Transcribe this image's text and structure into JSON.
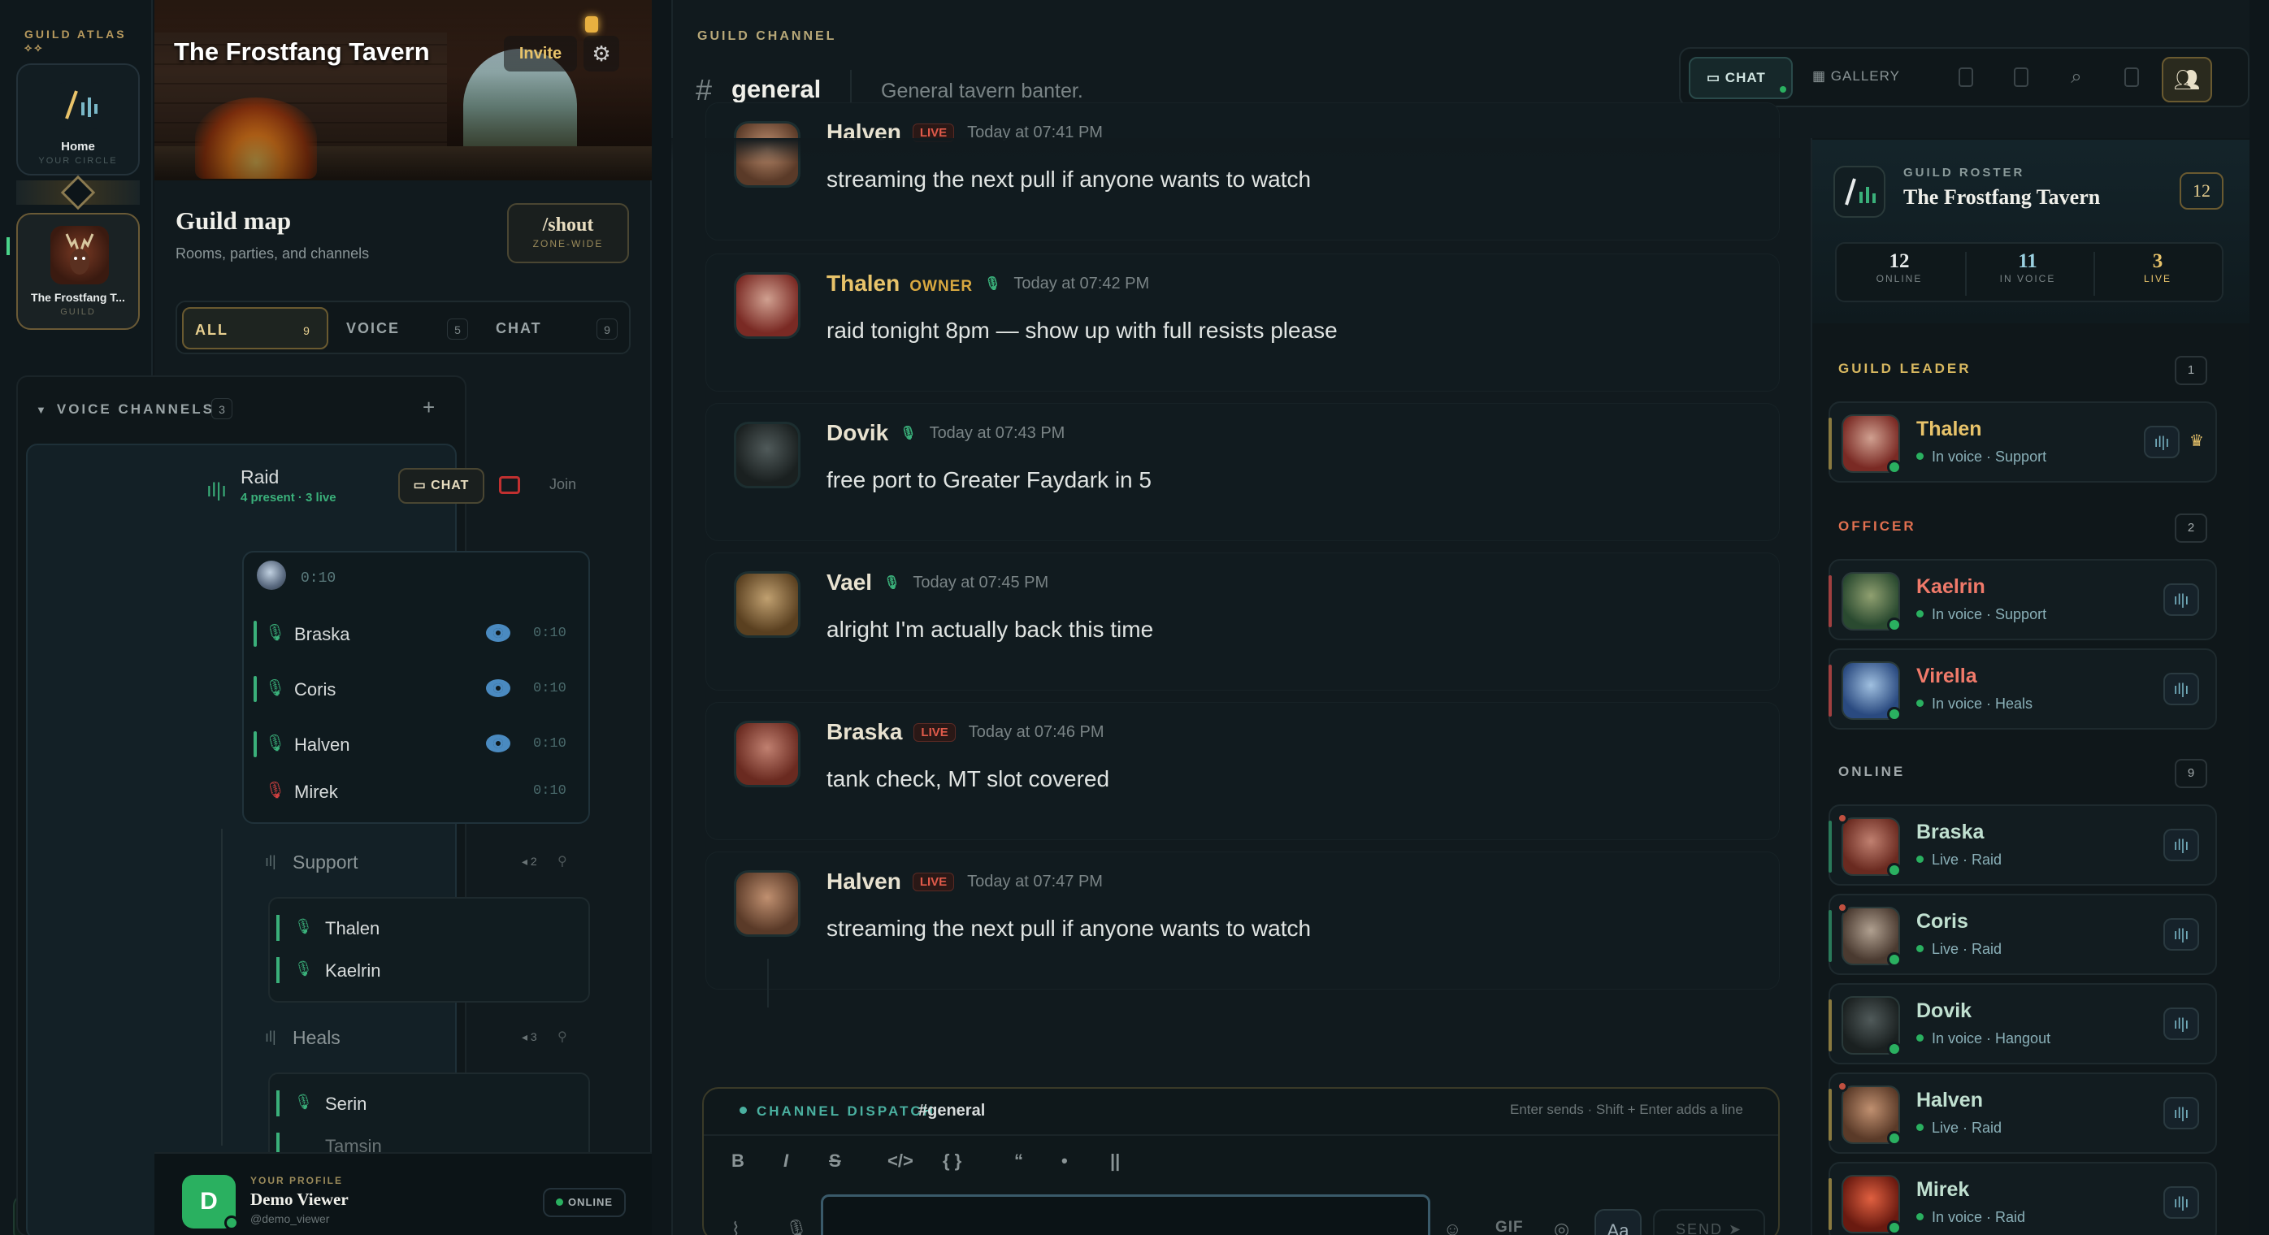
{
  "rail": {
    "title": "GUILD ATLAS ⟡⟡",
    "home_label": "Home",
    "home_sub": "YOUR CIRCLE",
    "guild_label": "The Frostfang T...",
    "guild_sub": "GUILD",
    "add_label": "+"
  },
  "guild": {
    "name": "The Frostfang Tavern",
    "invite": "Invite",
    "map_title": "Guild map",
    "map_sub": "Rooms, parties, and channels",
    "shout_cmd": "/shout",
    "shout_sub": "ZONE-WIDE",
    "filters": [
      {
        "label": "ALL",
        "count": "9"
      },
      {
        "label": "VOICE",
        "count": "5"
      },
      {
        "label": "CHAT",
        "count": "9"
      }
    ],
    "voice_header": "VOICE CHANNELS",
    "voice_count": "3",
    "raid": {
      "name": "Raid",
      "sub": "4 present · 3 live",
      "chat_btn": "CHAT",
      "join": "Join",
      "orb_time": "0:10",
      "members": [
        {
          "name": "Braska",
          "time": "0:10"
        },
        {
          "name": "Coris",
          "time": "0:10"
        },
        {
          "name": "Halven",
          "time": "0:10"
        },
        {
          "name": "Mirek",
          "time": "0:10"
        }
      ],
      "subgroups": [
        {
          "name": "Support",
          "count": "2",
          "members": [
            "Thalen",
            "Kaelrin"
          ]
        },
        {
          "name": "Heals",
          "count": "3",
          "members": [
            "Serin",
            "Tamsin"
          ]
        }
      ]
    }
  },
  "profile": {
    "initial": "D",
    "kicker": "YOUR PROFILE",
    "name": "Demo Viewer",
    "handle": "@demo_viewer",
    "status": "ONLINE"
  },
  "channel": {
    "kicker": "GUILD CHANNEL",
    "name": "general",
    "topic": "General tavern banter.",
    "tab_chat": "CHAT",
    "tab_gallery": "GALLERY"
  },
  "messages": [
    {
      "author": "Halven",
      "badge": "LIVE",
      "time": "Today at 07:41 PM",
      "text": "streaming the next pull if anyone wants to watch",
      "color": "#a07050"
    },
    {
      "author": "Thalen",
      "role": "OWNER",
      "time": "Today at 07:42 PM",
      "text": "raid tonight 8pm — show up with full resists please",
      "color": "#b04038"
    },
    {
      "author": "Dovik",
      "time": "Today at 07:43 PM",
      "text": "free port to Greater Faydark in 5",
      "color": "#2a3438"
    },
    {
      "author": "Vael",
      "time": "Today at 07:45 PM",
      "text": "alright I'm actually back this time",
      "color": "#8a6a40"
    },
    {
      "author": "Braska",
      "badge": "LIVE",
      "time": "Today at 07:46 PM",
      "text": "tank check, MT slot covered",
      "color": "#a04030"
    },
    {
      "author": "Halven",
      "badge": "LIVE",
      "time": "Today at 07:47 PM",
      "text": "streaming the next pull if anyone wants to watch",
      "color": "#a07050"
    }
  ],
  "composer": {
    "kicker": "CHANNEL DISPATCH",
    "channel": "#general",
    "hint": "Enter sends · Shift + Enter adds a line",
    "format": [
      "B",
      "I",
      "S",
      "</>",
      "{ }",
      "“",
      "•",
      "||"
    ],
    "gif": "GIF",
    "aa": "Aa",
    "send": "SEND"
  },
  "roster": {
    "kicker": "GUILD ROSTER",
    "name": "The Frostfang Tavern",
    "total": "12",
    "stats": [
      {
        "value": "12",
        "label": "ONLINE"
      },
      {
        "value": "11",
        "label": "IN VOICE"
      },
      {
        "value": "3",
        "label": "LIVE"
      }
    ],
    "sections": [
      {
        "title": "GUILD LEADER",
        "count": "1",
        "color": "#d8b860"
      },
      {
        "title": "OFFICER",
        "count": "2",
        "color": "#e07050"
      },
      {
        "title": "ONLINE",
        "count": "9",
        "color": "#a0a8aa"
      }
    ],
    "members": [
      {
        "name": "Thalen",
        "status": "In voice · Support",
        "color": "#e8c36a",
        "stripe": "#8a7a40"
      },
      {
        "name": "Kaelrin",
        "status": "In voice · Support",
        "color": "#f07a6a",
        "stripe": "#a04040"
      },
      {
        "name": "Virella",
        "status": "In voice · Heals",
        "color": "#f07a6a",
        "stripe": "#a04040"
      },
      {
        "name": "Braska",
        "status": "Live · Raid",
        "color": "#c0e0d0",
        "stripe": "#2a7a5a"
      },
      {
        "name": "Coris",
        "status": "Live · Raid",
        "color": "#c0e0d0",
        "stripe": "#2a7a5a"
      },
      {
        "name": "Dovik",
        "status": "In voice · Hangout",
        "color": "#c0e0d0",
        "stripe": "#2a7a5a"
      },
      {
        "name": "Halven",
        "status": "Live · Raid",
        "color": "#c0e0d0",
        "stripe": "#2a7a5a"
      },
      {
        "name": "Mirek",
        "status": "In voice · Raid",
        "color": "#c0e0d0",
        "stripe": "#2a7a5a"
      }
    ]
  }
}
